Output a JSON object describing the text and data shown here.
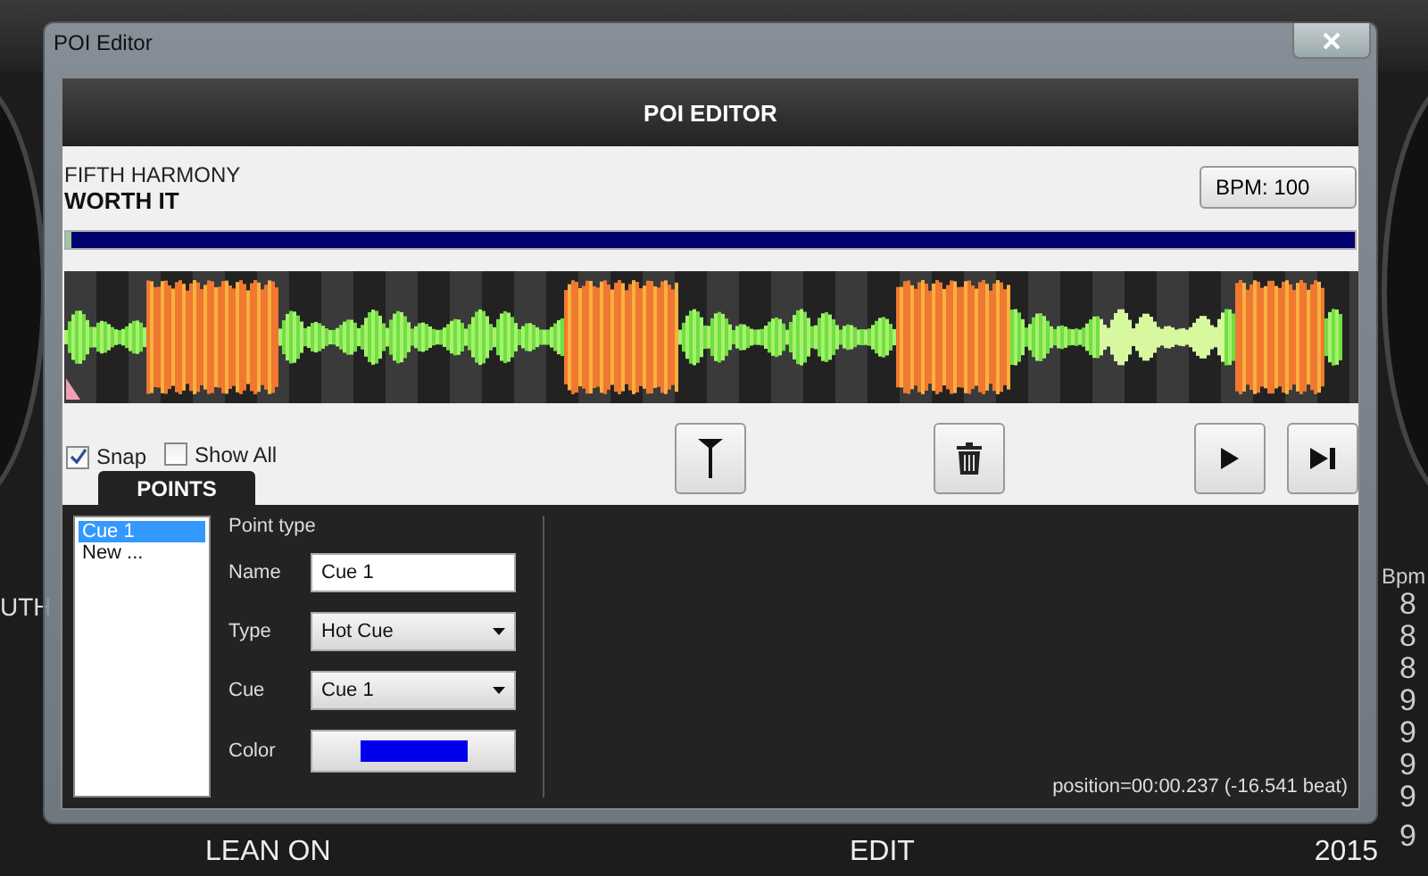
{
  "background": {
    "partial_text": "UTH",
    "column_header": "Bpm",
    "bpm_digits": [
      "8",
      "8",
      "8",
      "9",
      "9",
      "9",
      "9"
    ],
    "row": {
      "title": "LEAN ON",
      "type": "EDIT",
      "year": "2015",
      "bpm": "9"
    }
  },
  "window": {
    "title": "POI Editor"
  },
  "header": "POI EDITOR",
  "track": {
    "artist": "FIFTH HARMONY",
    "title": "WORTH IT"
  },
  "bpm_button": "BPM: 100",
  "progress": {
    "level": 0.004
  },
  "options": [
    {
      "label": "Snap",
      "checked": true
    },
    {
      "label": "Show All",
      "checked": false
    }
  ],
  "tab": {
    "label": "POINTS",
    "selected": true
  },
  "points": [
    {
      "label": "Cue 1",
      "selected": true
    },
    {
      "label": "New ...",
      "selected": false
    }
  ],
  "form": {
    "heading": "Point type",
    "fields": [
      {
        "kind": "text",
        "label": "Name",
        "value": "Cue 1"
      },
      {
        "kind": "select",
        "label": "Type",
        "value": "Hot Cue"
      },
      {
        "kind": "select",
        "label": "Cue",
        "value": "Cue 1"
      },
      {
        "kind": "color",
        "label": "Color",
        "color": "#0000ee"
      }
    ]
  },
  "position": "position=00:00.237 (-16.541 beat)"
}
